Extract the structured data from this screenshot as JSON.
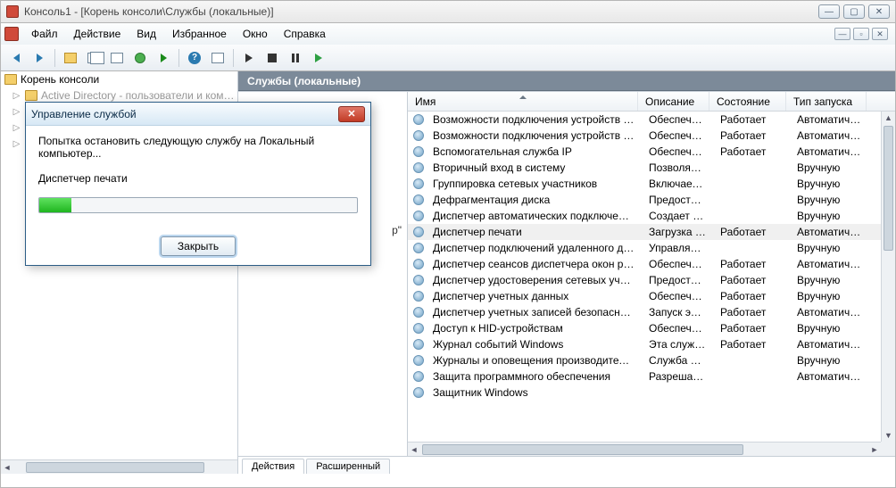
{
  "window": {
    "title": "Консоль1 - [Корень консоли\\Службы (локальные)]"
  },
  "menus": [
    "Файл",
    "Действие",
    "Вид",
    "Избранное",
    "Окно",
    "Справка"
  ],
  "tree": {
    "root": "Корень консоли",
    "item_partial": "Active Directory - пользователи и ком…"
  },
  "right": {
    "title": "Службы (локальные)",
    "desc_partial": "р\"",
    "columns": {
      "name": "Имя",
      "desc": "Описание",
      "state": "Состояние",
      "start": "Тип запуска"
    },
    "tabs": {
      "actions": "Действия",
      "extended": "Расширенный"
    }
  },
  "services": [
    {
      "name": "Возможности подключения устройств …",
      "desc": "Обеспечи…",
      "state": "Работает",
      "start": "Автоматиче…",
      "sel": false
    },
    {
      "name": "Возможности подключения устройств …",
      "desc": "Обеспечи…",
      "state": "Работает",
      "start": "Автоматиче…",
      "sel": false
    },
    {
      "name": "Вспомогательная служба IP",
      "desc": "Обеспечи…",
      "state": "Работает",
      "start": "Автоматиче…",
      "sel": false
    },
    {
      "name": "Вторичный вход в систему",
      "desc": "Позволяет…",
      "state": "",
      "start": "Вручную",
      "sel": false
    },
    {
      "name": "Группировка сетевых участников",
      "desc": "Включает …",
      "state": "",
      "start": "Вручную",
      "sel": false
    },
    {
      "name": "Дефрагментация диска",
      "desc": "Предостав…",
      "state": "",
      "start": "Вручную",
      "sel": false
    },
    {
      "name": "Диспетчер автоматических подключен…",
      "desc": "Создает п…",
      "state": "",
      "start": "Вручную",
      "sel": false
    },
    {
      "name": "Диспетчер печати",
      "desc": "Загрузка …",
      "state": "Работает",
      "start": "Автоматиче…",
      "sel": true
    },
    {
      "name": "Диспетчер подключений удаленного д…",
      "desc": "Управляет…",
      "state": "",
      "start": "Вручную",
      "sel": false
    },
    {
      "name": "Диспетчер сеансов диспетчера окон ра…",
      "desc": "Обеспечи…",
      "state": "Работает",
      "start": "Автоматиче…",
      "sel": false
    },
    {
      "name": "Диспетчер удостоверения сетевых учас…",
      "desc": "Предостав…",
      "state": "Работает",
      "start": "Вручную",
      "sel": false
    },
    {
      "name": "Диспетчер учетных данных",
      "desc": "Обеспечи…",
      "state": "Работает",
      "start": "Вручную",
      "sel": false
    },
    {
      "name": "Диспетчер учетных записей безопасно…",
      "desc": "Запуск это…",
      "state": "Работает",
      "start": "Автоматиче…",
      "sel": false
    },
    {
      "name": "Доступ к HID-устройствам",
      "desc": "Обеспечи…",
      "state": "Работает",
      "start": "Вручную",
      "sel": false
    },
    {
      "name": "Журнал событий Windows",
      "desc": "Эта служб…",
      "state": "Работает",
      "start": "Автоматиче…",
      "sel": false
    },
    {
      "name": "Журналы и оповещения производител…",
      "desc": "Служба ж…",
      "state": "",
      "start": "Вручную",
      "sel": false
    },
    {
      "name": "Защита программного обеспечения",
      "desc": "Разрешает…",
      "state": "",
      "start": "Автоматиче…",
      "sel": false
    },
    {
      "name": "Защитник Windows",
      "desc": "",
      "state": "",
      "start": "",
      "sel": false
    }
  ],
  "modal": {
    "title": "Управление службой",
    "line1": "Попытка остановить следующую службу на Локальный компьютер...",
    "line2": "Диспетчер печати",
    "close": "Закрыть",
    "progress_percent": 10
  }
}
